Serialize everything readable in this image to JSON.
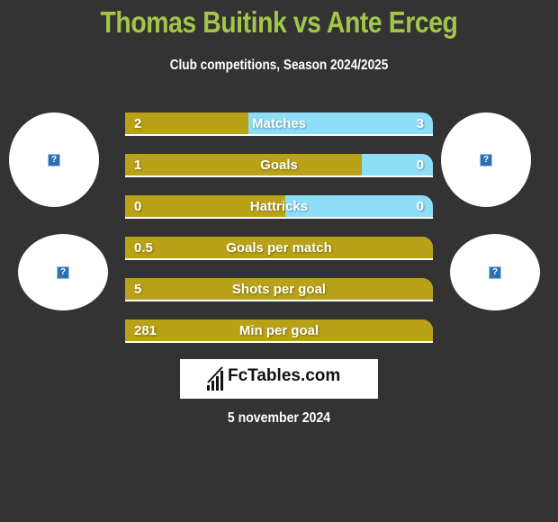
{
  "header": {
    "title": "Thomas Buitink vs Ante Erceg",
    "subtitle": "Club competitions, Season 2024/2025"
  },
  "players": {
    "left": {
      "name": "Thomas Buitink",
      "avatar_icon": "broken-image-icon",
      "club_icon": "broken-image-icon"
    },
    "right": {
      "name": "Ante Erceg",
      "avatar_icon": "broken-image-icon",
      "club_icon": "broken-image-icon"
    }
  },
  "colors": {
    "title": "#a2c64a",
    "left_bar": "#b9a217",
    "right_bar": "#8fdef8",
    "background": "#333333"
  },
  "stats": [
    {
      "label": "Matches",
      "left": "2",
      "right": "3",
      "left_share": 0.4
    },
    {
      "label": "Goals",
      "left": "1",
      "right": "0",
      "left_share": 0.77
    },
    {
      "label": "Hattricks",
      "left": "0",
      "right": "0",
      "left_share": 0.52
    },
    {
      "label": "Goals per match",
      "left": "0.5",
      "right": "",
      "left_share": 1.0
    },
    {
      "label": "Shots per goal",
      "left": "5",
      "right": "",
      "left_share": 1.0
    },
    {
      "label": "Min per goal",
      "left": "281",
      "right": "",
      "left_share": 1.0
    }
  ],
  "logo": {
    "text": "FcTables.com",
    "icon": "bar-chart-icon"
  },
  "date": "5 november 2024"
}
